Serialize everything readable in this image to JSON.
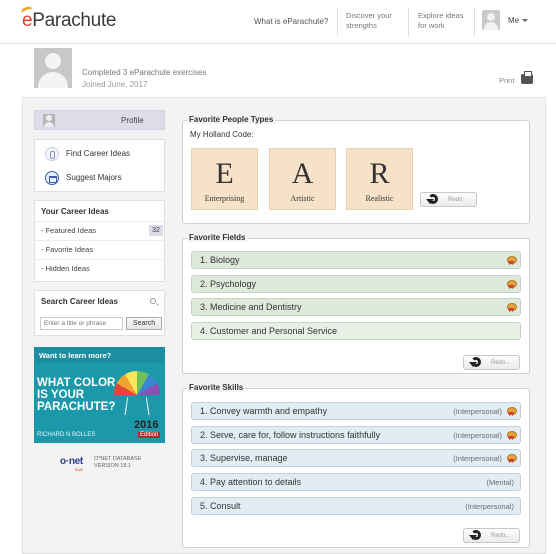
{
  "header": {
    "logo_e": "e",
    "logo_rest": "Parachute",
    "nav_what": "What is eParachute?",
    "nav_discover": "Discover your strengths",
    "nav_explore": "Explore ideas for work",
    "user_label": "Me"
  },
  "profile": {
    "completed": "Completed 3 eParachute exercises",
    "joined": "Joined June, 2017",
    "print_label": "Print"
  },
  "sidebar": {
    "profile_label": "Profile",
    "find_career": "Find Career Ideas",
    "suggest_majors": "Suggest Majors",
    "career_ideas_title": "Your Career Ideas",
    "featured": "- Featured Ideas",
    "featured_count": "32",
    "favorite": "- Favorite Ideas",
    "hidden": "- Hidden Ideas",
    "search_title": "Search Career Ideas",
    "search_placeholder": "Enter a title or phrase",
    "search_button": "Search"
  },
  "ad": {
    "want_more": "Want to learn more?",
    "book_title": "WHAT COLOR IS YOUR PARACHUTE?",
    "author": "RICHARD N BOLLES",
    "year": "2016",
    "edition": "Edition"
  },
  "onet": {
    "logo": "o·net",
    "sub": "Built",
    "database": "O*NET DATABASE VERSION 18.1"
  },
  "people_types": {
    "title": "Favorite People Types",
    "holland_label": "My Holland Code:",
    "types": [
      {
        "letter": "E",
        "name": "Enterprising"
      },
      {
        "letter": "A",
        "name": "Artistic"
      },
      {
        "letter": "R",
        "name": "Realistic"
      }
    ],
    "redo_label": "Redo"
  },
  "fields": {
    "title": "Favorite Fields",
    "items": [
      "1. Biology",
      "2. Psychology",
      "3. Medicine and Dentistry",
      "4. Customer and Personal Service"
    ],
    "redo_label": "Redo..."
  },
  "skills": {
    "title": "Favorite Skills",
    "items": [
      {
        "label": "1. Convey warmth and empathy",
        "category": "(Interpersonal)"
      },
      {
        "label": "2. Serve, care for, follow instructions faithfully",
        "category": "(Interpersonal)"
      },
      {
        "label": "3. Supervise, manage",
        "category": "(Interpersonal)"
      },
      {
        "label": "4. Pay attention to details",
        "category": "(Mental)"
      },
      {
        "label": "5. Consult",
        "category": "(Interpersonal)"
      }
    ],
    "redo_label": "Redo..."
  }
}
